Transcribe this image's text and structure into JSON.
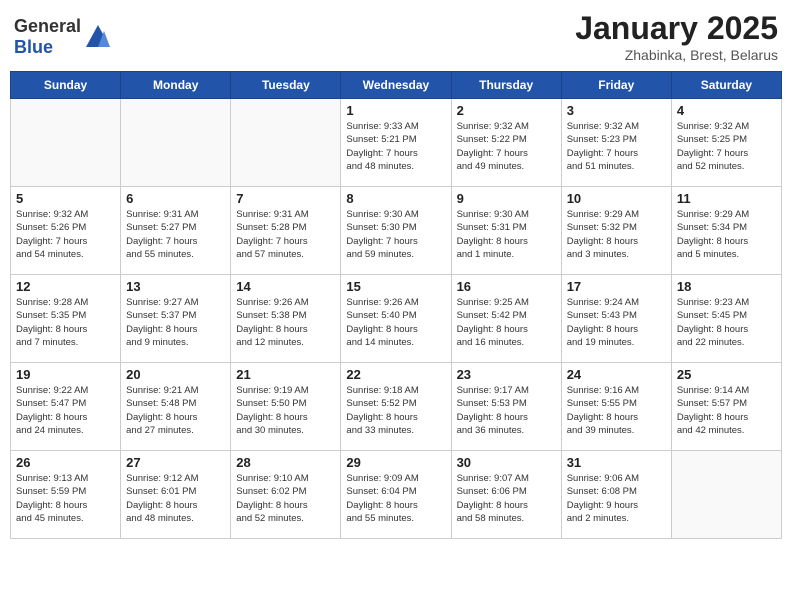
{
  "header": {
    "logo_general": "General",
    "logo_blue": "Blue",
    "month_title": "January 2025",
    "location": "Zhabinka, Brest, Belarus"
  },
  "days_of_week": [
    "Sunday",
    "Monday",
    "Tuesday",
    "Wednesday",
    "Thursday",
    "Friday",
    "Saturday"
  ],
  "weeks": [
    [
      {
        "day": "",
        "info": ""
      },
      {
        "day": "",
        "info": ""
      },
      {
        "day": "",
        "info": ""
      },
      {
        "day": "1",
        "info": "Sunrise: 9:33 AM\nSunset: 5:21 PM\nDaylight: 7 hours\nand 48 minutes."
      },
      {
        "day": "2",
        "info": "Sunrise: 9:32 AM\nSunset: 5:22 PM\nDaylight: 7 hours\nand 49 minutes."
      },
      {
        "day": "3",
        "info": "Sunrise: 9:32 AM\nSunset: 5:23 PM\nDaylight: 7 hours\nand 51 minutes."
      },
      {
        "day": "4",
        "info": "Sunrise: 9:32 AM\nSunset: 5:25 PM\nDaylight: 7 hours\nand 52 minutes."
      }
    ],
    [
      {
        "day": "5",
        "info": "Sunrise: 9:32 AM\nSunset: 5:26 PM\nDaylight: 7 hours\nand 54 minutes."
      },
      {
        "day": "6",
        "info": "Sunrise: 9:31 AM\nSunset: 5:27 PM\nDaylight: 7 hours\nand 55 minutes."
      },
      {
        "day": "7",
        "info": "Sunrise: 9:31 AM\nSunset: 5:28 PM\nDaylight: 7 hours\nand 57 minutes."
      },
      {
        "day": "8",
        "info": "Sunrise: 9:30 AM\nSunset: 5:30 PM\nDaylight: 7 hours\nand 59 minutes."
      },
      {
        "day": "9",
        "info": "Sunrise: 9:30 AM\nSunset: 5:31 PM\nDaylight: 8 hours\nand 1 minute."
      },
      {
        "day": "10",
        "info": "Sunrise: 9:29 AM\nSunset: 5:32 PM\nDaylight: 8 hours\nand 3 minutes."
      },
      {
        "day": "11",
        "info": "Sunrise: 9:29 AM\nSunset: 5:34 PM\nDaylight: 8 hours\nand 5 minutes."
      }
    ],
    [
      {
        "day": "12",
        "info": "Sunrise: 9:28 AM\nSunset: 5:35 PM\nDaylight: 8 hours\nand 7 minutes."
      },
      {
        "day": "13",
        "info": "Sunrise: 9:27 AM\nSunset: 5:37 PM\nDaylight: 8 hours\nand 9 minutes."
      },
      {
        "day": "14",
        "info": "Sunrise: 9:26 AM\nSunset: 5:38 PM\nDaylight: 8 hours\nand 12 minutes."
      },
      {
        "day": "15",
        "info": "Sunrise: 9:26 AM\nSunset: 5:40 PM\nDaylight: 8 hours\nand 14 minutes."
      },
      {
        "day": "16",
        "info": "Sunrise: 9:25 AM\nSunset: 5:42 PM\nDaylight: 8 hours\nand 16 minutes."
      },
      {
        "day": "17",
        "info": "Sunrise: 9:24 AM\nSunset: 5:43 PM\nDaylight: 8 hours\nand 19 minutes."
      },
      {
        "day": "18",
        "info": "Sunrise: 9:23 AM\nSunset: 5:45 PM\nDaylight: 8 hours\nand 22 minutes."
      }
    ],
    [
      {
        "day": "19",
        "info": "Sunrise: 9:22 AM\nSunset: 5:47 PM\nDaylight: 8 hours\nand 24 minutes."
      },
      {
        "day": "20",
        "info": "Sunrise: 9:21 AM\nSunset: 5:48 PM\nDaylight: 8 hours\nand 27 minutes."
      },
      {
        "day": "21",
        "info": "Sunrise: 9:19 AM\nSunset: 5:50 PM\nDaylight: 8 hours\nand 30 minutes."
      },
      {
        "day": "22",
        "info": "Sunrise: 9:18 AM\nSunset: 5:52 PM\nDaylight: 8 hours\nand 33 minutes."
      },
      {
        "day": "23",
        "info": "Sunrise: 9:17 AM\nSunset: 5:53 PM\nDaylight: 8 hours\nand 36 minutes."
      },
      {
        "day": "24",
        "info": "Sunrise: 9:16 AM\nSunset: 5:55 PM\nDaylight: 8 hours\nand 39 minutes."
      },
      {
        "day": "25",
        "info": "Sunrise: 9:14 AM\nSunset: 5:57 PM\nDaylight: 8 hours\nand 42 minutes."
      }
    ],
    [
      {
        "day": "26",
        "info": "Sunrise: 9:13 AM\nSunset: 5:59 PM\nDaylight: 8 hours\nand 45 minutes."
      },
      {
        "day": "27",
        "info": "Sunrise: 9:12 AM\nSunset: 6:01 PM\nDaylight: 8 hours\nand 48 minutes."
      },
      {
        "day": "28",
        "info": "Sunrise: 9:10 AM\nSunset: 6:02 PM\nDaylight: 8 hours\nand 52 minutes."
      },
      {
        "day": "29",
        "info": "Sunrise: 9:09 AM\nSunset: 6:04 PM\nDaylight: 8 hours\nand 55 minutes."
      },
      {
        "day": "30",
        "info": "Sunrise: 9:07 AM\nSunset: 6:06 PM\nDaylight: 8 hours\nand 58 minutes."
      },
      {
        "day": "31",
        "info": "Sunrise: 9:06 AM\nSunset: 6:08 PM\nDaylight: 9 hours\nand 2 minutes."
      },
      {
        "day": "",
        "info": ""
      }
    ]
  ]
}
